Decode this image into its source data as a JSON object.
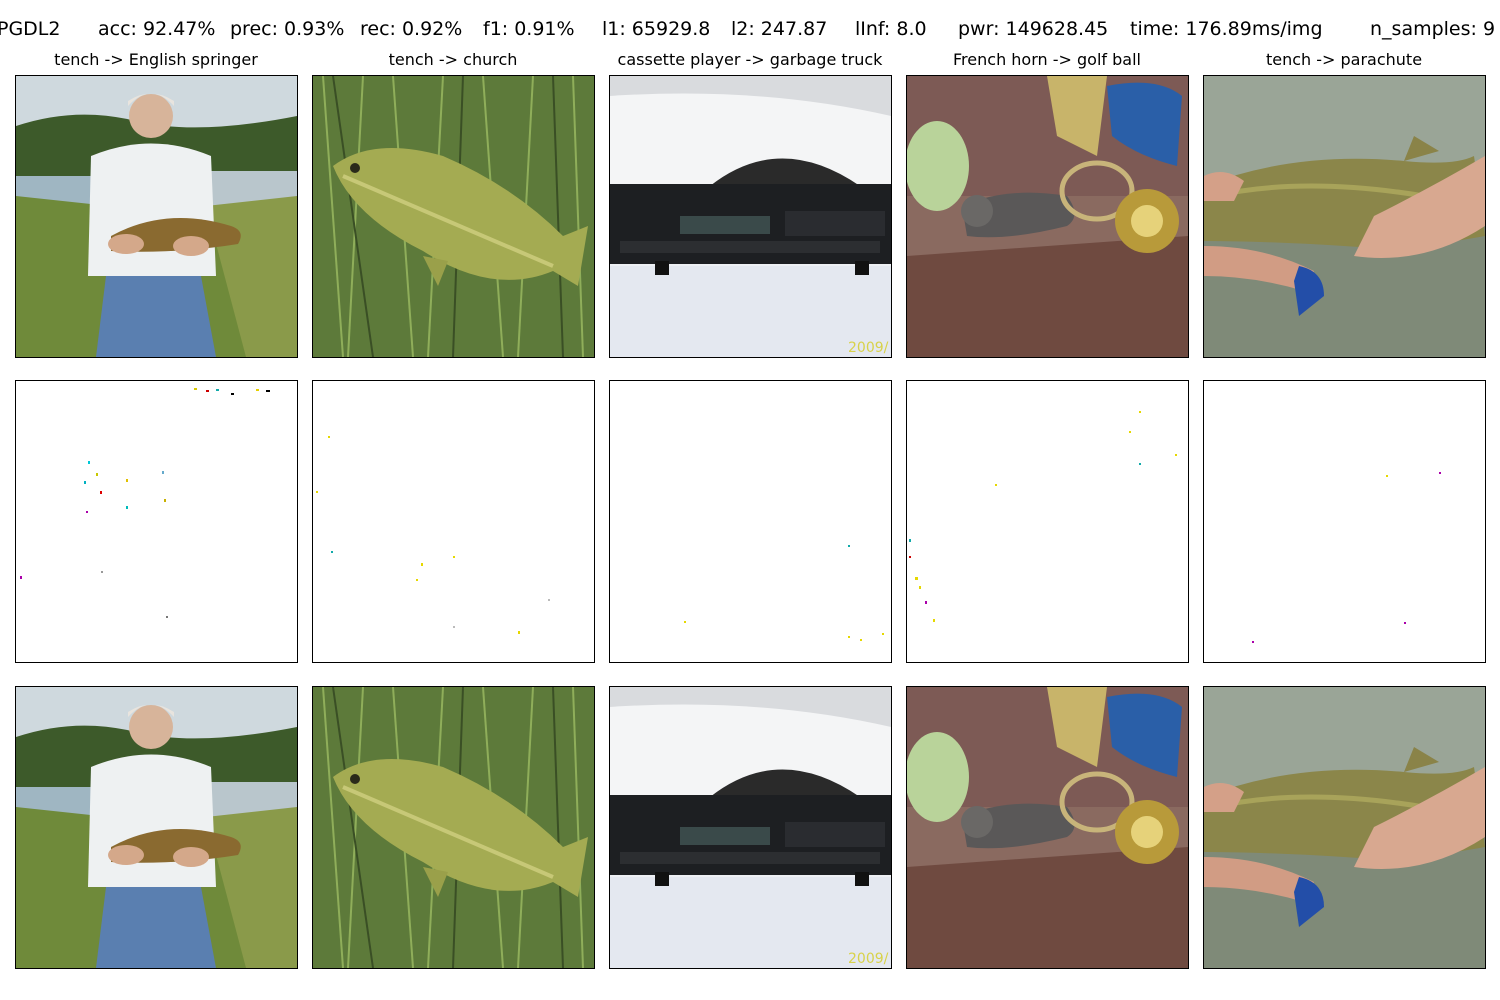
{
  "header": {
    "stats": [
      {
        "id": "method",
        "text": "PGDL2"
      },
      {
        "id": "acc",
        "text": "acc: 92.47%"
      },
      {
        "id": "prec",
        "text": "prec: 0.93%"
      },
      {
        "id": "rec",
        "text": "rec: 0.92%"
      },
      {
        "id": "f1",
        "text": "f1: 0.91%"
      },
      {
        "id": "l1",
        "text": "l1: 65929.8"
      },
      {
        "id": "l2",
        "text": "l2: 247.87"
      },
      {
        "id": "linf",
        "text": "lInf: 8.0"
      },
      {
        "id": "pwr",
        "text": "pwr: 149628.45"
      },
      {
        "id": "time",
        "text": "time: 176.89ms/img"
      },
      {
        "id": "nsamples",
        "text": "n_samples: 9"
      }
    ]
  },
  "columns": [
    {
      "title": "tench -> English springer",
      "scene": "man holding fish by lake"
    },
    {
      "title": "tench -> church",
      "scene": "fish lying in grass"
    },
    {
      "title": "cassette player -> garbage truck",
      "scene": "car radio unit in front of white car",
      "watermark": "2009/"
    },
    {
      "title": "French horn -> golf ball",
      "scene": "cat on sofa with french horn"
    },
    {
      "title": "tench -> parachute",
      "scene": "hands holding fish over water"
    }
  ],
  "rows": [
    {
      "id": "original",
      "kind": "photo"
    },
    {
      "id": "perturbation",
      "kind": "noise"
    },
    {
      "id": "adversarial",
      "kind": "photo"
    }
  ],
  "colors": {
    "panel_border": "#000000",
    "background": "#ffffff"
  }
}
